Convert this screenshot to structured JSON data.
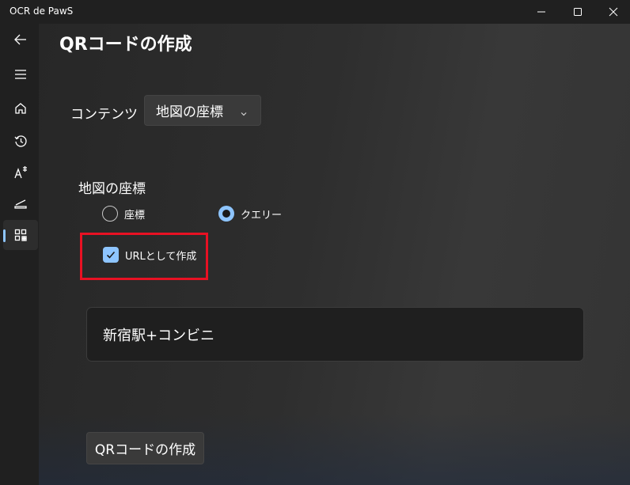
{
  "window": {
    "title": "OCR de PawS"
  },
  "nav": {
    "items": [
      {
        "icon": "back-arrow-icon"
      },
      {
        "icon": "hamburger-menu-icon"
      },
      {
        "icon": "home-icon"
      },
      {
        "icon": "history-icon"
      },
      {
        "icon": "text-recognition-icon"
      },
      {
        "icon": "scanner-icon"
      },
      {
        "icon": "qr-code-icon",
        "selected": true
      }
    ]
  },
  "page": {
    "title": "QRコードの作成"
  },
  "content_selector": {
    "label": "コンテンツ",
    "selected": "地図の座標"
  },
  "map_section": {
    "title": "地図の座標",
    "radio_options": [
      {
        "label": "座標",
        "checked": false
      },
      {
        "label": "クエリー",
        "checked": true
      }
    ],
    "url_checkbox": {
      "label": "URLとして作成",
      "checked": true
    },
    "query_value": "新宿駅+コンビニ"
  },
  "actions": {
    "create_label": "QRコードの作成"
  },
  "colors": {
    "accent": "#8ec5ff",
    "highlight": "#e81123",
    "background": "#202020"
  }
}
